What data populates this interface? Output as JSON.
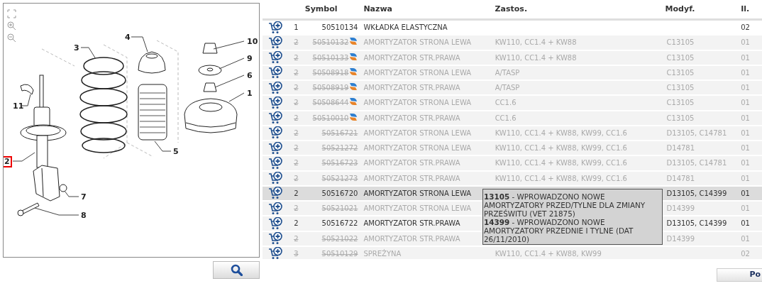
{
  "diagram": {
    "callouts": [
      {
        "label": "10",
        "selected": false
      },
      {
        "label": "9",
        "selected": false
      },
      {
        "label": "6",
        "selected": false
      },
      {
        "label": "1",
        "selected": false
      },
      {
        "label": "3",
        "selected": false
      },
      {
        "label": "4",
        "selected": false
      },
      {
        "label": "11",
        "selected": false
      },
      {
        "label": "2",
        "selected": true
      },
      {
        "label": "5",
        "selected": false
      },
      {
        "label": "7",
        "selected": false
      },
      {
        "label": "8",
        "selected": false
      }
    ]
  },
  "table": {
    "columns": [
      "Symbol",
      "Nazwa",
      "Zastos.",
      "Modyf.",
      "Il."
    ],
    "rows": [
      {
        "qty": "1",
        "symbol": "50510134",
        "name": "WKŁADKA ELASTYCZNA",
        "quantity": "02",
        "superseded": false,
        "replacement": false,
        "highlighted": false
      },
      {
        "qty": "2",
        "symbol": "50510132",
        "name": "AMORTYZATOR STRONA LEWA",
        "application": "KW110, CC1.4 + KW88",
        "modification": "C13105",
        "quantity": "01",
        "superseded": true,
        "replacement": true,
        "highlighted": false
      },
      {
        "qty": "2",
        "symbol": "50510133",
        "name": "AMORTYZATOR STR.PRAWA",
        "application": "KW110, CC1.4 + KW88",
        "modification": "C13105",
        "quantity": "01",
        "superseded": true,
        "replacement": true,
        "highlighted": false
      },
      {
        "qty": "2",
        "symbol": "50508918",
        "name": "AMORTYZATOR STRONA LEWA",
        "application": "A/TASP",
        "modification": "C13105",
        "quantity": "01",
        "superseded": true,
        "replacement": true,
        "highlighted": false
      },
      {
        "qty": "2",
        "symbol": "50508919",
        "name": "AMORTYZATOR STR.PRAWA",
        "application": "A/TASP",
        "modification": "C13105",
        "quantity": "01",
        "superseded": true,
        "replacement": true,
        "highlighted": false
      },
      {
        "qty": "2",
        "symbol": "50508644",
        "name": "AMORTYZATOR STRONA LEWA",
        "application": "CC1.6",
        "modification": "C13105",
        "quantity": "01",
        "superseded": true,
        "replacement": true,
        "highlighted": false
      },
      {
        "qty": "2",
        "symbol": "50510010",
        "name": "AMORTYZATOR STR.PRAWA",
        "application": "CC1.6",
        "modification": "C13105",
        "quantity": "01",
        "superseded": true,
        "replacement": true,
        "highlighted": false
      },
      {
        "qty": "2",
        "symbol": "50516721",
        "name": "AMORTYZATOR STRONA LEWA",
        "application": "KW110, CC1.4 + KW88, KW99, CC1.6",
        "modification": "D13105, C14781",
        "quantity": "01",
        "superseded": true,
        "replacement": false,
        "highlighted": false
      },
      {
        "qty": "2",
        "symbol": "50521272",
        "name": "AMORTYZATOR STRONA LEWA",
        "application": "KW110, CC1.4 + KW88, KW99, CC1.6",
        "modification": "D14781",
        "quantity": "01",
        "superseded": true,
        "replacement": false,
        "highlighted": false
      },
      {
        "qty": "2",
        "symbol": "50516723",
        "name": "AMORTYZATOR STR.PRAWA",
        "application": "KW110, CC1.4 + KW88, KW99, CC1.6",
        "modification": "D13105, C14781",
        "quantity": "01",
        "superseded": true,
        "replacement": false,
        "highlighted": false
      },
      {
        "qty": "2",
        "symbol": "50521273",
        "name": "AMORTYZATOR STR.PRAWA",
        "application": "KW110, CC1.4 + KW88, KW99, CC1.6",
        "modification": "D14781",
        "quantity": "01",
        "superseded": true,
        "replacement": false,
        "highlighted": false
      },
      {
        "qty": "2",
        "symbol": "50516720",
        "name": "AMORTYZATOR STRONA LEWA",
        "modification": "D13105, C14399",
        "quantity": "01",
        "superseded": false,
        "replacement": false,
        "highlighted": true
      },
      {
        "qty": "2",
        "symbol": "50521021",
        "name": "AMORTYZATOR STRONA LEWA",
        "modification": "D14399",
        "quantity": "01",
        "superseded": true,
        "replacement": false,
        "highlighted": false
      },
      {
        "qty": "2",
        "symbol": "50516722",
        "name": "AMORTYZATOR STR.PRAWA",
        "modification": "D13105, C14399",
        "quantity": "01",
        "superseded": false,
        "replacement": false,
        "highlighted": false
      },
      {
        "qty": "2",
        "symbol": "50521022",
        "name": "AMORTYZATOR STR.PRAWA",
        "modification": "D14399",
        "quantity": "01",
        "superseded": true,
        "replacement": false,
        "highlighted": false
      },
      {
        "qty": "3",
        "symbol": "50510129",
        "name": "SPREŻYNA",
        "application": "KW110, CC1.4 + KW88, KW99",
        "quantity": "02",
        "superseded": true,
        "replacement": false,
        "highlighted": false
      }
    ]
  },
  "tooltip": {
    "entries": [
      "**13105** - WPROWADZONO NOWE AMORTYZATORY PRZED/TYLNE DLA ZMIANY PRZEŚWITU (VET 21875)",
      "**14399** - WPROWADZONO NOWE AMORTYZATORY PRZEDNIE I TYLNE (DAT 26/11/2010)"
    ]
  },
  "footer_button": {
    "label": "Po"
  }
}
